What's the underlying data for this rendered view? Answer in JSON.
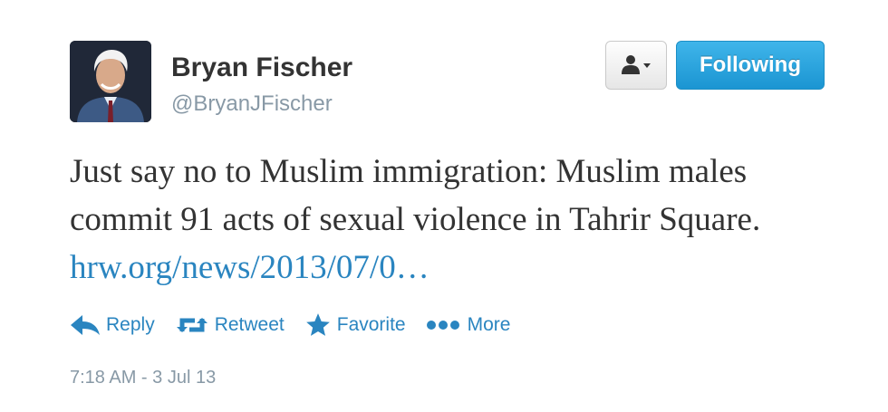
{
  "user": {
    "name": "Bryan Fischer",
    "handle": "@BryanJFischer"
  },
  "buttons": {
    "follow_label": "Following"
  },
  "tweet": {
    "text_plain": "Just say no to Muslim immigration: Muslim males commit 91 acts of sexual violence in Tahrir Square.",
    "link_text": "hrw.org/news/2013/07/0…"
  },
  "actions": {
    "reply": "Reply",
    "retweet": "Retweet",
    "favorite": "Favorite",
    "more": "More"
  },
  "timestamp": "7:18 AM - 3 Jul 13",
  "colors": {
    "link": "#2a85c0",
    "follow_bg": "#2aa7e2",
    "muted": "#8899a6",
    "text": "#333333"
  },
  "icons": {
    "user_dropdown": "person-caret-icon",
    "reply": "reply-arrow-icon",
    "retweet": "retweet-icon",
    "favorite": "star-icon",
    "more": "dots-icon"
  }
}
